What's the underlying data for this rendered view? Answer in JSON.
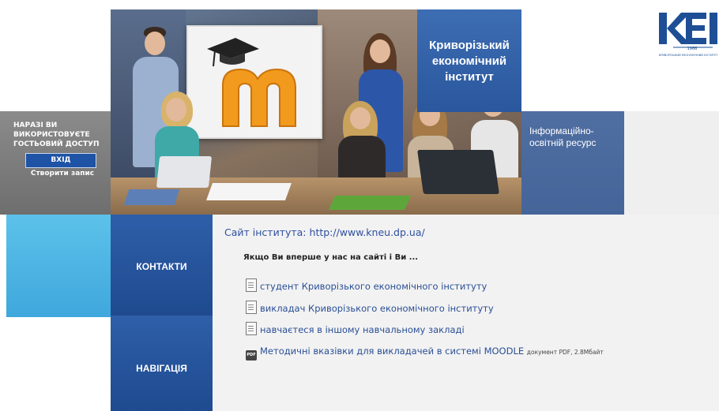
{
  "guest_panel": {
    "status_text": "НАРАЗІ ВИ ВИКОРИСТОВУЄТЕ ГОСТЬОВИЙ ДОСТУП",
    "login_label": "ВХІД",
    "create_account_label": "Створити запис"
  },
  "header": {
    "title_lines": [
      "Криворізький",
      "економічний",
      "інститут"
    ],
    "subtitle_lines": [
      "Інформаційно-",
      "освітній ресурс"
    ]
  },
  "logo": {
    "letters": "KEI",
    "year": "1966",
    "caption": "КРИВОРІЗЬКИЙ ЕКОНОМІЧНИЙ ІНСТИТУТ"
  },
  "nav": {
    "contacts_label": "КОНТАКТИ",
    "navigation_label": "НАВІГАЦІЯ"
  },
  "content": {
    "site_label": "Сайт інститута:",
    "site_url": "http://www.kneu.dp.ua/",
    "intro": "Якщо Ви вперше у нас на сайті і Ви ...",
    "entries": [
      {
        "text": "студент Криворізького економічного інституту",
        "icon": "document-icon"
      },
      {
        "text": "викладач Криворізького економічного інституту",
        "icon": "document-icon"
      },
      {
        "text": "навчаєтеся в іншому навчальному закладі",
        "icon": "document-icon"
      },
      {
        "text": "Методичні вказівки для викладачей в системі MOODLE",
        "icon": "pdf-icon",
        "note": "документ PDF, 2.8Мбайт"
      }
    ]
  },
  "colors": {
    "brand_blue": "#2a579d",
    "link_blue": "#2e4fa0",
    "sky_blue": "#4fb5e3"
  }
}
